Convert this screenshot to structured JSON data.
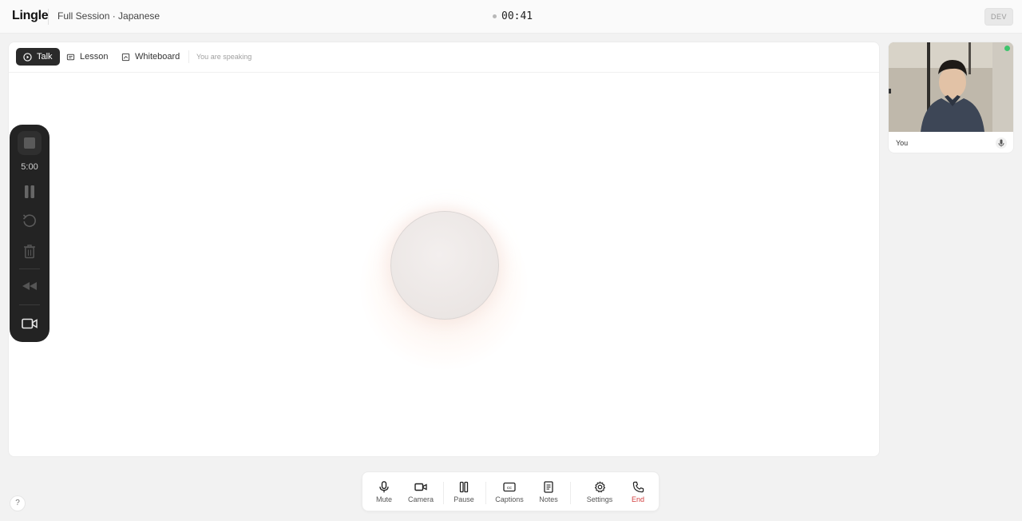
{
  "app": {
    "logo": "Lingle",
    "session_title": "Full Session · Japanese",
    "timer": "00:41",
    "dev_label": "DEV"
  },
  "tabs": [
    {
      "label": "Talk",
      "icon": "play-circle-icon",
      "active": true
    },
    {
      "label": "Lesson",
      "icon": "book-icon",
      "active": false
    },
    {
      "label": "Whiteboard",
      "icon": "whiteboard-icon",
      "active": false
    }
  ],
  "status_text": "You are speaking",
  "toolbar": {
    "time": "5:00",
    "items": [
      "stop-icon",
      "pause-icon",
      "reset-icon",
      "trash-icon",
      "rewind-icon",
      "camera-icon"
    ]
  },
  "video": {
    "label": "You",
    "mic_icon": "mic-icon"
  },
  "controls": [
    {
      "label": "Mute",
      "icon": "mic-icon"
    },
    {
      "label": "Camera",
      "icon": "camera-icon"
    },
    {
      "label": "Pause",
      "icon": "pause-icon"
    },
    {
      "label": "Captions",
      "icon": "captions-icon"
    },
    {
      "label": "Notes",
      "icon": "notes-icon"
    },
    {
      "label": "Settings",
      "icon": "settings-icon"
    },
    {
      "label": "End",
      "icon": "phone-icon"
    }
  ],
  "help_label": "?",
  "colors": {
    "accent_dark": "#2a2a2a",
    "end_red": "#d23c3c",
    "live_green": "#3ec46d"
  }
}
